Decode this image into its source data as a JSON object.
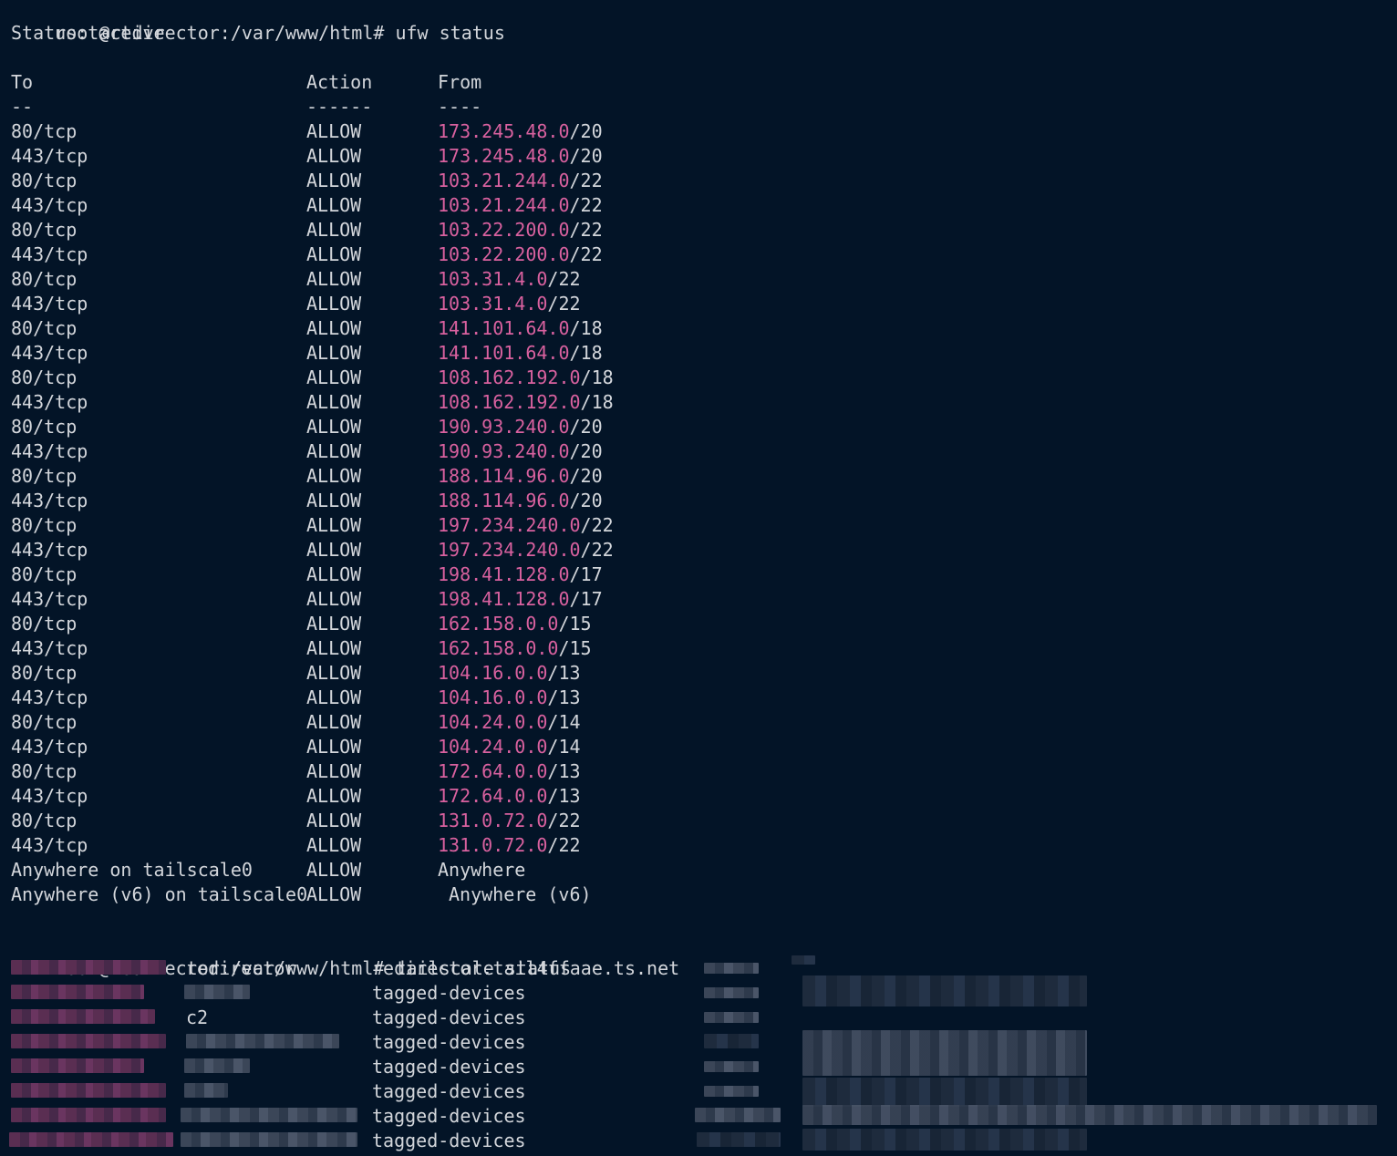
{
  "prompt": "root@redirector:/var/www/html#",
  "command_ufw": "ufw status",
  "status_line": "Status: active",
  "headers": {
    "to": "To",
    "action": "Action",
    "from": "From"
  },
  "separators": {
    "to": "--",
    "action": "------",
    "from": "----"
  },
  "rules": [
    {
      "to": "80/tcp",
      "action": "ALLOW",
      "ip": "173.245.48.0",
      "mask": "/20"
    },
    {
      "to": "443/tcp",
      "action": "ALLOW",
      "ip": "173.245.48.0",
      "mask": "/20"
    },
    {
      "to": "80/tcp",
      "action": "ALLOW",
      "ip": "103.21.244.0",
      "mask": "/22"
    },
    {
      "to": "443/tcp",
      "action": "ALLOW",
      "ip": "103.21.244.0",
      "mask": "/22"
    },
    {
      "to": "80/tcp",
      "action": "ALLOW",
      "ip": "103.22.200.0",
      "mask": "/22"
    },
    {
      "to": "443/tcp",
      "action": "ALLOW",
      "ip": "103.22.200.0",
      "mask": "/22"
    },
    {
      "to": "80/tcp",
      "action": "ALLOW",
      "ip": "103.31.4.0",
      "mask": "/22"
    },
    {
      "to": "443/tcp",
      "action": "ALLOW",
      "ip": "103.31.4.0",
      "mask": "/22"
    },
    {
      "to": "80/tcp",
      "action": "ALLOW",
      "ip": "141.101.64.0",
      "mask": "/18"
    },
    {
      "to": "443/tcp",
      "action": "ALLOW",
      "ip": "141.101.64.0",
      "mask": "/18"
    },
    {
      "to": "80/tcp",
      "action": "ALLOW",
      "ip": "108.162.192.0",
      "mask": "/18"
    },
    {
      "to": "443/tcp",
      "action": "ALLOW",
      "ip": "108.162.192.0",
      "mask": "/18"
    },
    {
      "to": "80/tcp",
      "action": "ALLOW",
      "ip": "190.93.240.0",
      "mask": "/20"
    },
    {
      "to": "443/tcp",
      "action": "ALLOW",
      "ip": "190.93.240.0",
      "mask": "/20"
    },
    {
      "to": "80/tcp",
      "action": "ALLOW",
      "ip": "188.114.96.0",
      "mask": "/20"
    },
    {
      "to": "443/tcp",
      "action": "ALLOW",
      "ip": "188.114.96.0",
      "mask": "/20"
    },
    {
      "to": "80/tcp",
      "action": "ALLOW",
      "ip": "197.234.240.0",
      "mask": "/22"
    },
    {
      "to": "443/tcp",
      "action": "ALLOW",
      "ip": "197.234.240.0",
      "mask": "/22"
    },
    {
      "to": "80/tcp",
      "action": "ALLOW",
      "ip": "198.41.128.0",
      "mask": "/17"
    },
    {
      "to": "443/tcp",
      "action": "ALLOW",
      "ip": "198.41.128.0",
      "mask": "/17"
    },
    {
      "to": "80/tcp",
      "action": "ALLOW",
      "ip": "162.158.0.0",
      "mask": "/15"
    },
    {
      "to": "443/tcp",
      "action": "ALLOW",
      "ip": "162.158.0.0",
      "mask": "/15"
    },
    {
      "to": "80/tcp",
      "action": "ALLOW",
      "ip": "104.16.0.0",
      "mask": "/13"
    },
    {
      "to": "443/tcp",
      "action": "ALLOW",
      "ip": "104.16.0.0",
      "mask": "/13"
    },
    {
      "to": "80/tcp",
      "action": "ALLOW",
      "ip": "104.24.0.0",
      "mask": "/14"
    },
    {
      "to": "443/tcp",
      "action": "ALLOW",
      "ip": "104.24.0.0",
      "mask": "/14"
    },
    {
      "to": "80/tcp",
      "action": "ALLOW",
      "ip": "172.64.0.0",
      "mask": "/13"
    },
    {
      "to": "443/tcp",
      "action": "ALLOW",
      "ip": "172.64.0.0",
      "mask": "/13"
    },
    {
      "to": "80/tcp",
      "action": "ALLOW",
      "ip": "131.0.72.0",
      "mask": "/22"
    },
    {
      "to": "443/tcp",
      "action": "ALLOW",
      "ip": "131.0.72.0",
      "mask": "/22"
    }
  ],
  "tail_rules": [
    {
      "to": "Anywhere on tailscale0",
      "action": "ALLOW",
      "from": "Anywhere"
    },
    {
      "to": "Anywhere (v6) on tailscale0",
      "action": "ALLOW",
      "from": "Anywhere (v6)"
    }
  ],
  "command_tailscale": "tailscale status",
  "tailscale_rows": [
    {
      "name": "redirector",
      "user": "redirector.tail4ffaae.ts.net"
    },
    {
      "name": "",
      "user": "tagged-devices"
    },
    {
      "name": "c2",
      "user": "tagged-devices"
    },
    {
      "name": "",
      "user": "tagged-devices"
    },
    {
      "name": "",
      "user": "tagged-devices"
    },
    {
      "name": "",
      "user": "tagged-devices"
    },
    {
      "name": "",
      "user": "tagged-devices"
    },
    {
      "name": "",
      "user": "tagged-devices"
    }
  ],
  "colors": {
    "background": "#031427",
    "text": "#d3d6db",
    "ip_highlight": "#d9619f"
  }
}
